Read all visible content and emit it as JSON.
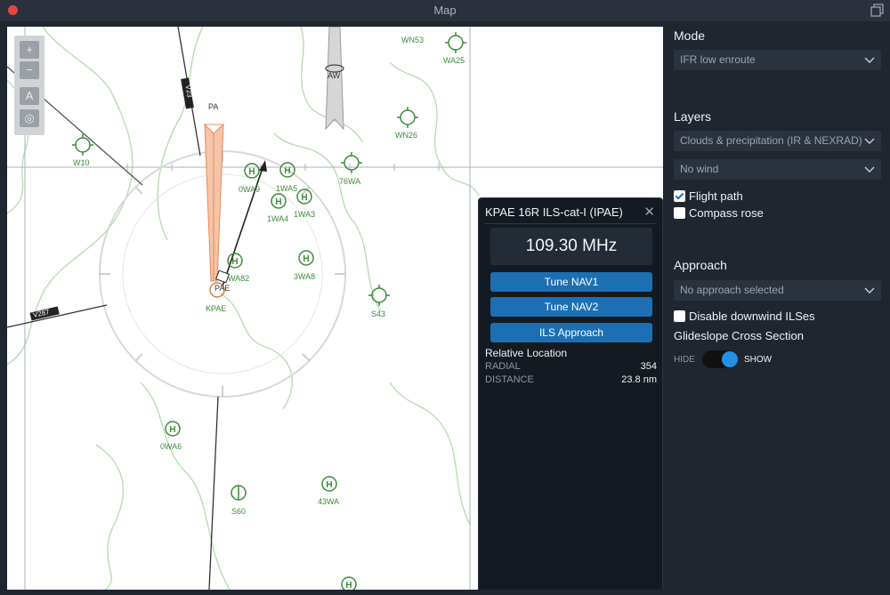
{
  "window": {
    "title": "Map"
  },
  "map": {
    "labels": {
      "wn53": "WN53",
      "wa25": "WA25",
      "pa": "PA",
      "aw": "AW",
      "w10": "W10",
      "wn26": "WN26",
      "wa9": "0WA9",
      "wa5": "1WA5",
      "wa76": "76WA",
      "wa4": "1WA4",
      "wa3": "1WA3",
      "wa82": "WA82",
      "wa8": "3WA8",
      "pae": "PAE",
      "kpae": "KPAE",
      "s43": "S43",
      "wa6": "0WA6",
      "s60": "S60",
      "wa43": "43WA",
      "v23": "V23",
      "v287": "V287"
    }
  },
  "popup": {
    "title": "KPAE 16R ILS-cat-I (IPAE)",
    "frequency": "109.30 MHz",
    "buttons": {
      "tune_nav1": "Tune NAV1",
      "tune_nav2": "Tune NAV2",
      "ils_approach": "ILS Approach"
    },
    "relative_location": {
      "heading": "Relative Location",
      "radial_label": "RADIAL",
      "radial_value": "354",
      "distance_label": "DISTANCE",
      "distance_value": "23.8 nm"
    }
  },
  "sidebar": {
    "mode": {
      "title": "Mode",
      "value": "IFR low enroute"
    },
    "layers": {
      "title": "Layers",
      "weather": "Clouds & precipitation (IR & NEXRAD)",
      "wind": "No wind",
      "flight_path": {
        "label": "Flight path",
        "checked": true
      },
      "compass_rose": {
        "label": "Compass rose",
        "checked": false
      }
    },
    "approach": {
      "title": "Approach",
      "value": "No approach selected",
      "disable_downwind": {
        "label": "Disable downwind ILSes",
        "checked": false
      },
      "glideslope_title": "Glideslope Cross Section",
      "toggle_hide": "HIDE",
      "toggle_show": "SHOW",
      "toggle_state": "show"
    }
  },
  "colors": {
    "accent": "#1c6fb3",
    "toggle_on": "#2391e6",
    "map_green": "#3c8a3c",
    "close": "#e2473c"
  }
}
